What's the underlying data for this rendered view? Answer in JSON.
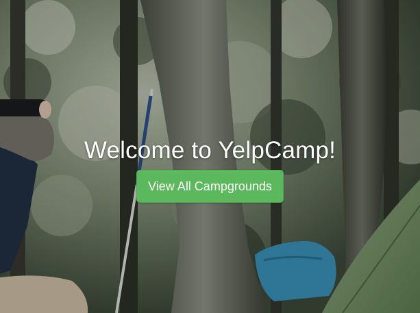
{
  "hero": {
    "title": "Welcome to YelpCamp!",
    "cta_label": "View All Campgrounds"
  },
  "colors": {
    "button_bg": "#5cb85c",
    "title_text": "#ffffff"
  }
}
